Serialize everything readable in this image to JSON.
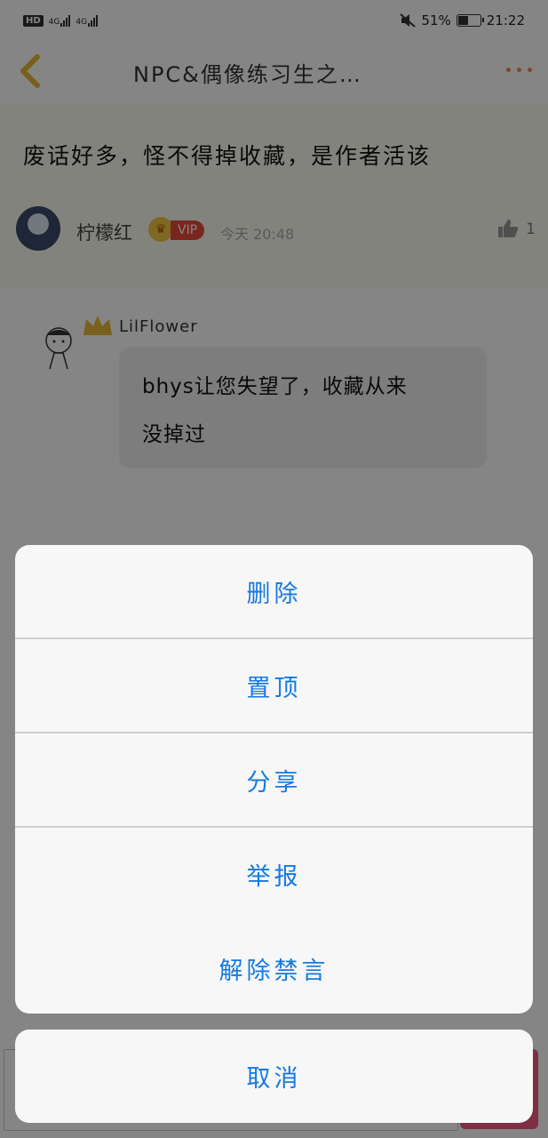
{
  "status_bar": {
    "hd_badge": "HD",
    "signal_1": "4G",
    "signal_2": "4G",
    "battery_percent": "51%",
    "battery_level": 0.51,
    "time": "21:22"
  },
  "nav": {
    "title": "NPC&偶像练习生之…",
    "back_icon": "chevron-left-icon",
    "more_icon": "more-dots-icon"
  },
  "post": {
    "text": "废话好多，怪不得掉收藏，是作者活该",
    "author": "柠檬红",
    "vip_label": "VIP",
    "time": "今天 20:48",
    "like_count": "1"
  },
  "reply": {
    "author": "LilFlower",
    "text_line1": "bhys让您失望了，收藏从来",
    "text_line2": "没掉过"
  },
  "action_sheet": {
    "items": [
      {
        "label": "删除"
      },
      {
        "label": "置顶"
      },
      {
        "label": "分享"
      },
      {
        "label": "举报"
      },
      {
        "label": "解除禁言"
      }
    ],
    "cancel_label": "取消"
  },
  "colors": {
    "accent": "#1679e0",
    "vip": "#e9493d",
    "more_dots": "#f08a4b"
  }
}
